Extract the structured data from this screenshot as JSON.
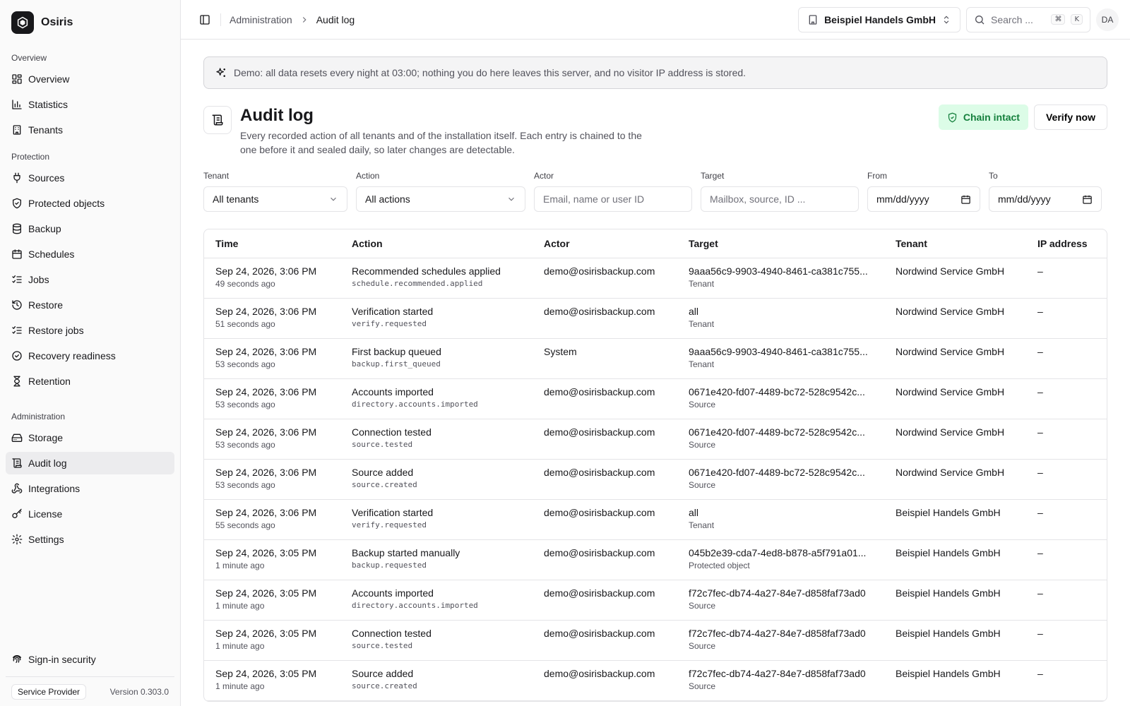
{
  "brand": {
    "name": "Osiris"
  },
  "sidebar": {
    "groups": [
      {
        "label": "Overview",
        "items": [
          {
            "label": "Overview",
            "icon": "dashboard-icon"
          },
          {
            "label": "Statistics",
            "icon": "bar-chart-icon"
          },
          {
            "label": "Tenants",
            "icon": "building-icon"
          }
        ]
      },
      {
        "label": "Protection",
        "items": [
          {
            "label": "Sources",
            "icon": "plug-icon"
          },
          {
            "label": "Protected objects",
            "icon": "shield-icon"
          },
          {
            "label": "Backup",
            "icon": "database-icon"
          },
          {
            "label": "Schedules",
            "icon": "calendar-icon"
          },
          {
            "label": "Jobs",
            "icon": "list-checks-icon"
          },
          {
            "label": "Restore",
            "icon": "history-icon"
          },
          {
            "label": "Restore jobs",
            "icon": "list-checks-icon"
          },
          {
            "label": "Recovery readiness",
            "icon": "circle-check-icon"
          },
          {
            "label": "Retention",
            "icon": "hourglass-icon"
          }
        ]
      },
      {
        "label": "Administration",
        "items": [
          {
            "label": "Storage",
            "icon": "hard-drive-icon"
          },
          {
            "label": "Audit log",
            "icon": "scroll-icon",
            "active": true
          },
          {
            "label": "Integrations",
            "icon": "webhook-icon"
          },
          {
            "label": "License",
            "icon": "key-icon"
          },
          {
            "label": "Settings",
            "icon": "gear-icon"
          }
        ]
      }
    ],
    "bottom_item": {
      "label": "Sign-in security",
      "icon": "fingerprint-icon"
    },
    "footer": {
      "badge": "Service Provider",
      "version": "Version 0.303.0"
    }
  },
  "topbar": {
    "breadcrumb_parent": "Administration",
    "breadcrumb_current": "Audit log",
    "tenant_selected": "Beispiel Handels GmbH",
    "search_placeholder": "Search ...",
    "kbd_cmd": "⌘",
    "kbd_key": "K",
    "avatar_initials": "DA"
  },
  "banner": {
    "text": "Demo: all data resets every night at 03:00; nothing you do here leaves this server, and no visitor IP address is stored."
  },
  "page": {
    "title": "Audit log",
    "description": "Every recorded action of all tenants and of the installation itself. Each entry is chained to the one before it and sealed daily, so later changes are detectable.",
    "chain_status": "Chain intact",
    "verify_label": "Verify now"
  },
  "filters": {
    "tenant": {
      "label": "Tenant",
      "value": "All tenants"
    },
    "action": {
      "label": "Action",
      "value": "All actions"
    },
    "actor": {
      "label": "Actor",
      "placeholder": "Email, name or user ID"
    },
    "target": {
      "label": "Target",
      "placeholder": "Mailbox, source, ID ..."
    },
    "from": {
      "label": "From",
      "value": "mm/dd/yyyy"
    },
    "to": {
      "label": "To",
      "value": "mm/dd/yyyy"
    }
  },
  "table": {
    "columns": [
      "Time",
      "Action",
      "Actor",
      "Target",
      "Tenant",
      "IP address"
    ],
    "rows": [
      {
        "time": "Sep 24, 2026, 3:06 PM",
        "ago": "49 seconds ago",
        "action": "Recommended schedules applied",
        "code": "schedule.recommended.applied",
        "actor": "demo@osirisbackup.com",
        "target": "9aaa56c9-9903-4940-8461-ca381c755...",
        "target_type": "Tenant",
        "tenant": "Nordwind Service GmbH",
        "ip": "–"
      },
      {
        "time": "Sep 24, 2026, 3:06 PM",
        "ago": "51 seconds ago",
        "action": "Verification started",
        "code": "verify.requested",
        "actor": "demo@osirisbackup.com",
        "target": "all",
        "target_type": "Tenant",
        "tenant": "Nordwind Service GmbH",
        "ip": "–"
      },
      {
        "time": "Sep 24, 2026, 3:06 PM",
        "ago": "53 seconds ago",
        "action": "First backup queued",
        "code": "backup.first_queued",
        "actor": "System",
        "target": "9aaa56c9-9903-4940-8461-ca381c755...",
        "target_type": "Tenant",
        "tenant": "Nordwind Service GmbH",
        "ip": "–"
      },
      {
        "time": "Sep 24, 2026, 3:06 PM",
        "ago": "53 seconds ago",
        "action": "Accounts imported",
        "code": "directory.accounts.imported",
        "actor": "demo@osirisbackup.com",
        "target": "0671e420-fd07-4489-bc72-528c9542c...",
        "target_type": "Source",
        "tenant": "Nordwind Service GmbH",
        "ip": "–"
      },
      {
        "time": "Sep 24, 2026, 3:06 PM",
        "ago": "53 seconds ago",
        "action": "Connection tested",
        "code": "source.tested",
        "actor": "demo@osirisbackup.com",
        "target": "0671e420-fd07-4489-bc72-528c9542c...",
        "target_type": "Source",
        "tenant": "Nordwind Service GmbH",
        "ip": "–"
      },
      {
        "time": "Sep 24, 2026, 3:06 PM",
        "ago": "53 seconds ago",
        "action": "Source added",
        "code": "source.created",
        "actor": "demo@osirisbackup.com",
        "target": "0671e420-fd07-4489-bc72-528c9542c...",
        "target_type": "Source",
        "tenant": "Nordwind Service GmbH",
        "ip": "–"
      },
      {
        "time": "Sep 24, 2026, 3:06 PM",
        "ago": "55 seconds ago",
        "action": "Verification started",
        "code": "verify.requested",
        "actor": "demo@osirisbackup.com",
        "target": "all",
        "target_type": "Tenant",
        "tenant": "Beispiel Handels GmbH",
        "ip": "–"
      },
      {
        "time": "Sep 24, 2026, 3:05 PM",
        "ago": "1 minute ago",
        "action": "Backup started manually",
        "code": "backup.requested",
        "actor": "demo@osirisbackup.com",
        "target": "045b2e39-cda7-4ed8-b878-a5f791a01...",
        "target_type": "Protected object",
        "tenant": "Beispiel Handels GmbH",
        "ip": "–"
      },
      {
        "time": "Sep 24, 2026, 3:05 PM",
        "ago": "1 minute ago",
        "action": "Accounts imported",
        "code": "directory.accounts.imported",
        "actor": "demo@osirisbackup.com",
        "target": "f72c7fec-db74-4a27-84e7-d858faf73ad0",
        "target_type": "Source",
        "tenant": "Beispiel Handels GmbH",
        "ip": "–"
      },
      {
        "time": "Sep 24, 2026, 3:05 PM",
        "ago": "1 minute ago",
        "action": "Connection tested",
        "code": "source.tested",
        "actor": "demo@osirisbackup.com",
        "target": "f72c7fec-db74-4a27-84e7-d858faf73ad0",
        "target_type": "Source",
        "tenant": "Beispiel Handels GmbH",
        "ip": "–"
      },
      {
        "time": "Sep 24, 2026, 3:05 PM",
        "ago": "1 minute ago",
        "action": "Source added",
        "code": "source.created",
        "actor": "demo@osirisbackup.com",
        "target": "f72c7fec-db74-4a27-84e7-d858faf73ad0",
        "target_type": "Source",
        "tenant": "Beispiel Handels GmbH",
        "ip": "–"
      }
    ]
  },
  "colors": {
    "accent": "#18181b",
    "success_bg": "#dcfce7",
    "success_fg": "#15803d",
    "active_nav": "#ececee"
  }
}
